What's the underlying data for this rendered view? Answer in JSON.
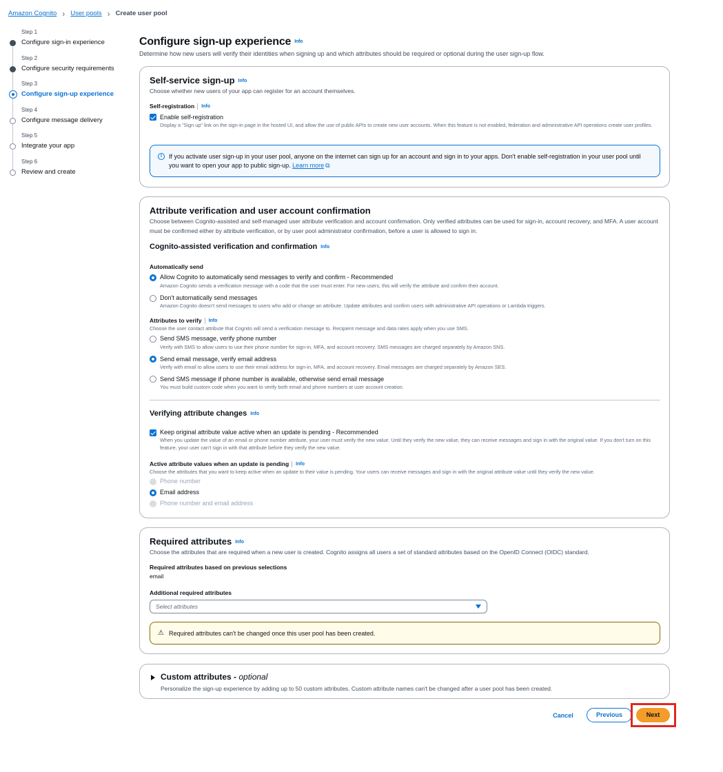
{
  "breadcrumb": {
    "item1": "Amazon Cognito",
    "item2": "User pools",
    "current": "Create user pool"
  },
  "steps": [
    {
      "num": "Step 1",
      "label": "Configure sign-in experience",
      "state": "complete"
    },
    {
      "num": "Step 2",
      "label": "Configure security requirements",
      "state": "complete"
    },
    {
      "num": "Step 3",
      "label": "Configure sign-up experience",
      "state": "active"
    },
    {
      "num": "Step 4",
      "label": "Configure message delivery",
      "state": "upcoming"
    },
    {
      "num": "Step 5",
      "label": "Integrate your app",
      "state": "upcoming"
    },
    {
      "num": "Step 6",
      "label": "Review and create",
      "state": "upcoming"
    }
  ],
  "info_link": "Info",
  "page": {
    "title": "Configure sign-up experience",
    "description": "Determine how new users will verify their identities when signing up and which attributes should be required or optional during the user sign-up flow."
  },
  "self_service": {
    "title": "Self-service sign-up",
    "description": "Choose whether new users of your app can register for an account themselves.",
    "field_label": "Self-registration",
    "checkbox_label": "Enable self-registration",
    "checkbox_checked": true,
    "checkbox_desc": "Display a \"Sign up\" link on the sign-in page in the hosted UI, and allow the use of public APIs to create new user accounts. When this feature is not enabled, federation and administrative API operations create user profiles.",
    "alert_text": "If you activate user sign-up in your user pool, anyone on the internet can sign up for an account and sign in to your apps. Don't enable self-registration in your user pool until you want to open your app to public sign-up.",
    "alert_link": "Learn more"
  },
  "verification": {
    "title": "Attribute verification and user account confirmation",
    "description": "Choose between Cognito-assisted and self-managed user attribute verification and account confirmation. Only verified attributes can be used for sign-in, account recovery, and MFA. A user account must be confirmed either by attribute verification, or by user pool administrator confirmation, before a user is allowed to sign in.",
    "sub_title": "Cognito-assisted verification and confirmation",
    "auto_send_label": "Automatically send",
    "auto_send_options": [
      {
        "label": "Allow Cognito to automatically send messages to verify and confirm - Recommended",
        "desc": "Amazon Cognito sends a verification message with a code that the user must enter. For new users, this will verify the attribute and confirm their account.",
        "selected": true
      },
      {
        "label": "Don't automatically send messages",
        "desc": "Amazon Cognito doesn't send messages to users who add or change an attribute. Update attributes and confirm users with administrative API operations or Lambda triggers.",
        "selected": false
      }
    ],
    "attrs_label": "Attributes to verify",
    "attrs_desc": "Choose the user contact attribute that Cognito will send a verification message to. Recipient message and data rates apply when you use SMS.",
    "attrs_options": [
      {
        "label": "Send SMS message, verify phone number",
        "desc": "Verify with SMS to allow users to use their phone number for sign-in, MFA, and account recovery. SMS messages are charged separately by Amazon SNS.",
        "selected": false
      },
      {
        "label": "Send email message, verify email address",
        "desc": "Verify with email to allow users to use their email address for sign-in, MFA, and account recovery. Email messages are charged separately by Amazon SES.",
        "selected": true
      },
      {
        "label": "Send SMS message if phone number is available, otherwise send email message",
        "desc": "You must build custom code when you want to verify both email and phone numbers at user account creation.",
        "selected": false
      }
    ],
    "changes_title": "Verifying attribute changes",
    "keep_label": "Keep original attribute value active when an update is pending - Recommended",
    "keep_checked": true,
    "keep_desc": "When you update the value of an email or phone number attribute, your user must verify the new value. Until they verify the new value, they can receive messages and sign in with the original value. If you don't turn on this feature, your user can't sign in with that attribute before they verify the new value.",
    "active_label": "Active attribute values when an update is pending",
    "active_desc": "Choose the attributes that you want to keep active when an update to their value is pending. Your users can receive messages and sign in with the original attribute value until they verify the new value.",
    "active_options": [
      {
        "label": "Phone number",
        "state": "disabled"
      },
      {
        "label": "Email address",
        "state": "selected"
      },
      {
        "label": "Phone number and email address",
        "state": "disabled"
      }
    ]
  },
  "required": {
    "title": "Required attributes",
    "description": "Choose the attributes that are required when a new user is created. Cognito assigns all users a set of standard attributes based on the OpenID Connect (OIDC) standard.",
    "based_label": "Required attributes based on previous selections",
    "based_value": "email",
    "additional_label": "Additional required attributes",
    "select_placeholder": "Select attributes",
    "warning_text": "Required attributes can't be changed once this user pool has been created."
  },
  "custom": {
    "title": "Custom attributes",
    "title_suffix": "optional",
    "description": "Personalize the sign-up experience by adding up to 50 custom attributes. Custom attribute names can't be changed after a user pool has been created."
  },
  "actions": {
    "cancel": "Cancel",
    "previous": "Previous",
    "next": "Next"
  },
  "colors": {
    "accent": "#0972d3",
    "primary_button": "#f39c2a",
    "highlight": "#e1261c"
  }
}
